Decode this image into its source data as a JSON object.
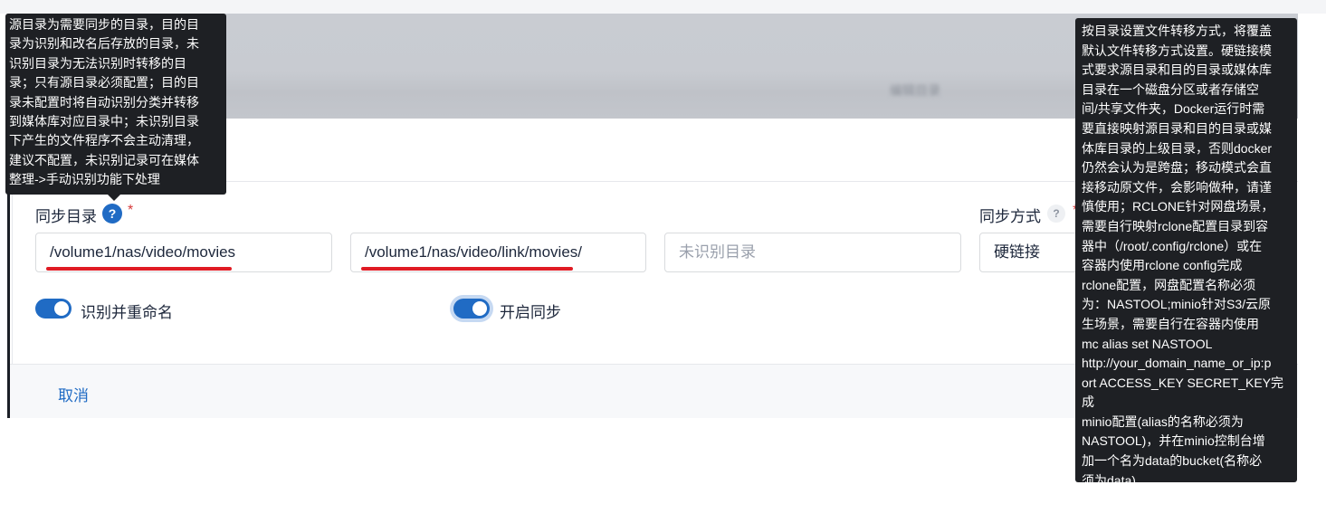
{
  "header": {
    "blurred_text": "编辑目录"
  },
  "form": {
    "sync_dir_label": "同步目录",
    "sync_dir_help_icon": "?",
    "required_mark": "*",
    "sync_mode_label": "同步方式",
    "sync_mode_help_icon": "?",
    "source_dir_value": "/volume1/nas/video/movies",
    "target_dir_value": "/volume1/nas/video/link/movies/",
    "unknown_dir_placeholder": "未识别目录",
    "sync_mode_value": "硬链接",
    "rename_toggle": {
      "label": "识别并重命名",
      "checked": true
    },
    "enable_sync_toggle": {
      "label": "开启同步",
      "checked": true
    }
  },
  "footer": {
    "cancel_label": "取消"
  },
  "tooltips": {
    "sync_dir": "源目录为需要同步的目录，目的目\n录为识别和改名后存放的目录，未\n识别目录为无法识别时转移的目\n录；只有源目录必须配置；目的目\n录未配置时将自动识别分类并转移\n到媒体库对应目录中；未识别目录\n下产生的文件程序不会主动清理，\n建议不配置，未识别记录可在媒体\n整理->手动识别功能下处理",
    "sync_mode": "按目录设置文件转移方式，将覆盖\n默认文件转移方式设置。硬链接模\n式要求源目录和目的目录或媒体库\n目录在一个磁盘分区或者存储空\n间/共享文件夹，Docker运行时需\n要直接映射源目录和目的目录或媒\n体库目录的上级目录，否则docker\n仍然会认为是跨盘；移动模式会直\n接移动原文件，会影响做种，请谨\n慎使用；RCLONE针对网盘场景，\n需要自行映射rclone配置目录到容\n器中（/root/.config/rclone）或在\n容器内使用rclone config完成\nrclone配置，网盘配置名称必须\n为：NASTOOL;minio针对S3/云原\n生场景，需要自行在容器内使用\nmc alias set NASTOOL\nhttp://your_domain_name_or_ip:p\nort ACCESS_KEY SECRET_KEY完成\nminio配置(alias的名称必须为\nNASTOOL)，并在minio控制台增\n加一个名为data的bucket(名称必\n须为data)"
  },
  "colors": {
    "accent": "#206bc4",
    "required": "#d63939",
    "annotation_underline": "#e01b24",
    "tooltip_bg": "#1e2024"
  }
}
